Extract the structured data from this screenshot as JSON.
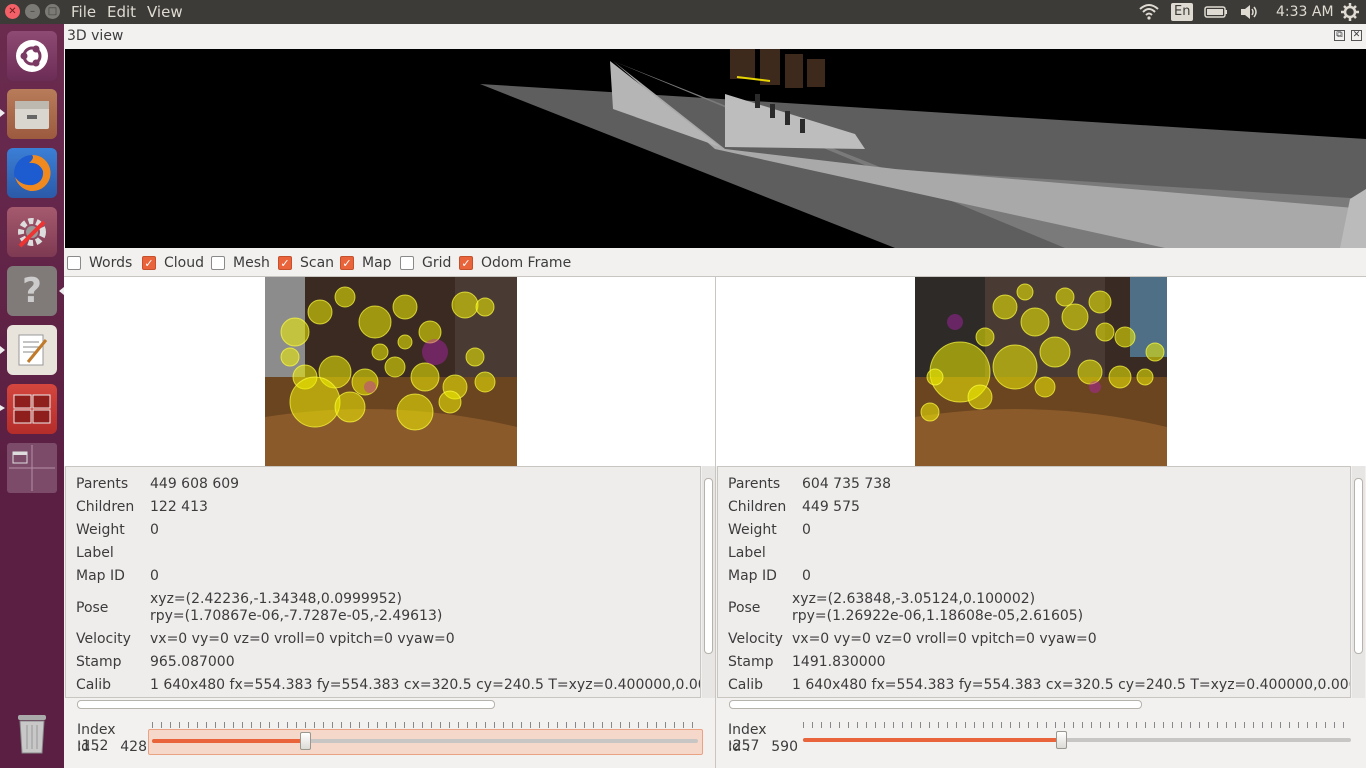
{
  "topbar": {
    "menus": [
      "File",
      "Edit",
      "View"
    ],
    "input_lang": "En",
    "time": "4:33 AM"
  },
  "launcher": {
    "items": [
      "ubuntu-dash-icon",
      "files-icon",
      "firefox-icon",
      "system-settings-icon",
      "help-icon",
      "text-editor-icon",
      "terminal-icon",
      "workspace-switcher-icon",
      "trash-icon"
    ]
  },
  "dock": {
    "title": "3D view"
  },
  "checkboxes": [
    {
      "label": "Words",
      "checked": false
    },
    {
      "label": "Cloud",
      "checked": true
    },
    {
      "label": "Mesh",
      "checked": false
    },
    {
      "label": "Scan",
      "checked": true
    },
    {
      "label": "Map",
      "checked": true
    },
    {
      "label": "Grid",
      "checked": false
    },
    {
      "label": "Odom Frame",
      "checked": true
    }
  ],
  "left": {
    "labels": {
      "parents": "Parents",
      "children": "Children",
      "weight": "Weight",
      "label": "Label",
      "mapid": "Map ID",
      "pose": "Pose",
      "velocity": "Velocity",
      "stamp": "Stamp",
      "calib": "Calib"
    },
    "parents": "449 608 609",
    "children": "122 413",
    "weight": "0",
    "label": "",
    "mapid": "0",
    "pose_xyz": "xyz=(2.42236,-1.34348,0.0999952)",
    "pose_rpy": "rpy=(1.70867e-06,-7.7287e-05,-2.49613)",
    "velocity": "vx=0 vy=0 vz=0 vroll=0 vpitch=0 vyaw=0",
    "stamp": "965.087000",
    "calib": "1 640x480 fx=554.383 fy=554.383 cx=320.5 cy=240.5 T=xyz=0.400000,0.000000,0.0",
    "index_label": "Index :",
    "index": "152",
    "id_label": "Id :",
    "id": "428",
    "slider_fraction": 0.28
  },
  "right": {
    "labels": {
      "parents": "Parents",
      "children": "Children",
      "weight": "Weight",
      "label": "Label",
      "mapid": "Map ID",
      "pose": "Pose",
      "velocity": "Velocity",
      "stamp": "Stamp",
      "calib": "Calib"
    },
    "parents": "604 735 738",
    "children": "449 575",
    "weight": "0",
    "label": "",
    "mapid": "0",
    "pose_xyz": "xyz=(2.63848,-3.05124,0.100002)",
    "pose_rpy": "rpy=(1.26922e-06,1.18608e-05,2.61605)",
    "velocity": "vx=0 vy=0 vz=0 vroll=0 vpitch=0 vyaw=0",
    "stamp": "1491.830000",
    "calib": "1 640x480 fx=554.383 fy=554.383 cx=320.5 cy=240.5 T=xyz=0.400000,0.000000,0.0",
    "index_label": "Index :",
    "index": "257",
    "id_label": "Id :",
    "id": "590",
    "slider_fraction": 0.47
  },
  "colors": {
    "accent": "#e9643b",
    "launcher": "#5e2750",
    "topbar": "#3c3b37"
  }
}
